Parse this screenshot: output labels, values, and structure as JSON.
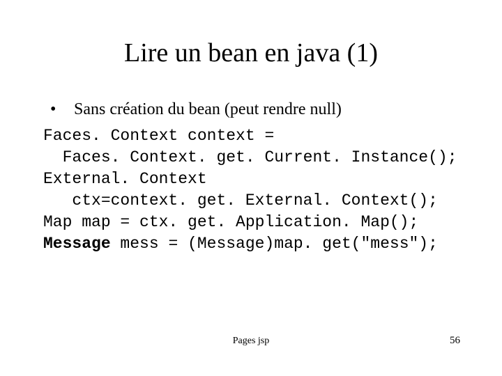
{
  "title": "Lire un bean en java (1)",
  "bullet": {
    "marker": "•",
    "text": "Sans création du bean (peut rendre null)"
  },
  "code": {
    "l1": "Faces. Context context = ",
    "l2": "  Faces. Context. get. Current. Instance();",
    "l3": "External. Context ",
    "l4": "   ctx=context. get. External. Context();",
    "l5": "Map map = ctx. get. Application. Map();",
    "l6a": "Message",
    "l6b": " mess = (Message)map. get(\"mess\");"
  },
  "footer": {
    "center": "Pages jsp",
    "pageNumber": "56"
  }
}
